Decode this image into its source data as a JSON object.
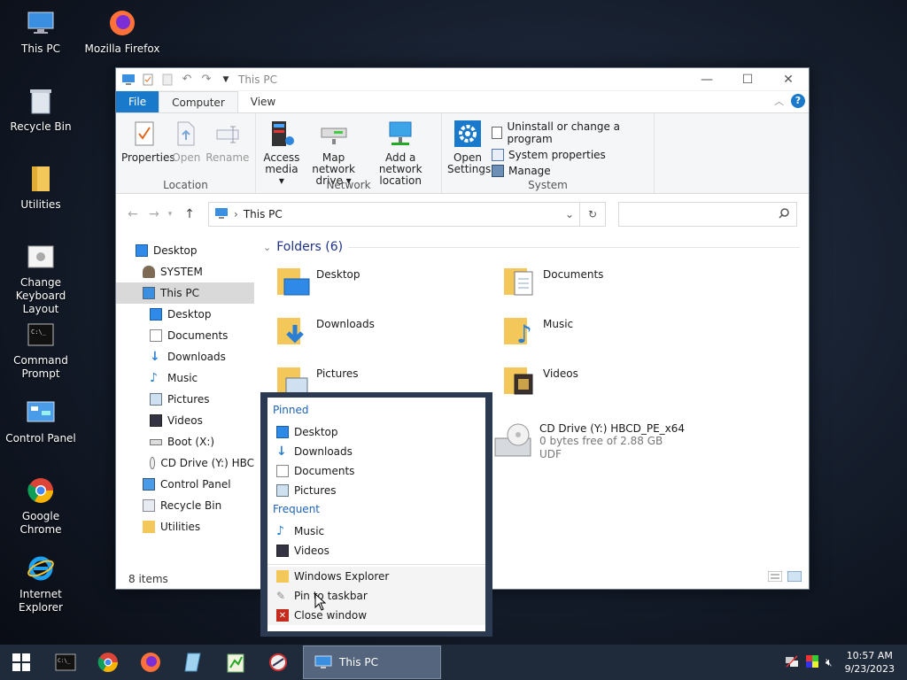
{
  "desktop": {
    "icons": [
      {
        "label": "This PC"
      },
      {
        "label": "Mozilla Firefox"
      },
      {
        "label": "Recycle Bin"
      },
      {
        "label": "Utilities"
      },
      {
        "label": "Change Keyboard Layout"
      },
      {
        "label": "Command Prompt"
      },
      {
        "label": "Control Panel"
      },
      {
        "label": "Google Chrome"
      },
      {
        "label": "Internet Explorer"
      }
    ]
  },
  "window": {
    "title": "This PC",
    "tabs": {
      "file": "File",
      "computer": "Computer",
      "view": "View"
    },
    "ribbon": {
      "location": {
        "name": "Location",
        "properties": "Properties",
        "open": "Open",
        "rename": "Rename"
      },
      "network": {
        "name": "Network",
        "access_media": "Access media ▾",
        "map_drive": "Map network drive ▾",
        "add_location": "Add a network location"
      },
      "system": {
        "name": "System",
        "open_settings": "Open Settings",
        "uninstall": "Uninstall or change a program",
        "sys_props": "System properties",
        "manage": "Manage"
      }
    },
    "address": {
      "path": "This PC",
      "search_placeholder": ""
    },
    "nav": [
      {
        "label": "Desktop"
      },
      {
        "label": "SYSTEM"
      },
      {
        "label": "This PC"
      },
      {
        "label": "Desktop"
      },
      {
        "label": "Documents"
      },
      {
        "label": "Downloads"
      },
      {
        "label": "Music"
      },
      {
        "label": "Pictures"
      },
      {
        "label": "Videos"
      },
      {
        "label": "Boot (X:)"
      },
      {
        "label": "CD Drive (Y:) HBC"
      },
      {
        "label": "Control Panel"
      },
      {
        "label": "Recycle Bin"
      },
      {
        "label": "Utilities"
      }
    ],
    "folders_header": "Folders (6)",
    "folders": [
      {
        "label": "Desktop"
      },
      {
        "label": "Documents"
      },
      {
        "label": "Downloads"
      },
      {
        "label": "Music"
      },
      {
        "label": "Pictures"
      },
      {
        "label": "Videos"
      }
    ],
    "drive": {
      "name": "CD Drive (Y:) HBCD_PE_x64",
      "free": "0 bytes free of 2.88 GB",
      "fs": "UDF"
    },
    "status": "8 items"
  },
  "jumplist": {
    "pinned_header": "Pinned",
    "pinned": [
      {
        "label": "Desktop"
      },
      {
        "label": "Downloads"
      },
      {
        "label": "Documents"
      },
      {
        "label": "Pictures"
      }
    ],
    "frequent_header": "Frequent",
    "frequent": [
      {
        "label": "Music"
      },
      {
        "label": "Videos"
      }
    ],
    "tasks": [
      {
        "label": "Windows Explorer"
      },
      {
        "label": "Pin to taskbar"
      },
      {
        "label": "Close window"
      }
    ]
  },
  "taskbar": {
    "active_window": "This PC",
    "time": "10:57 AM",
    "date": "9/23/2023"
  },
  "colors": {
    "accent": "#1979ca",
    "folder": "#f3c75a",
    "taskbar": "#1f2a3a"
  }
}
